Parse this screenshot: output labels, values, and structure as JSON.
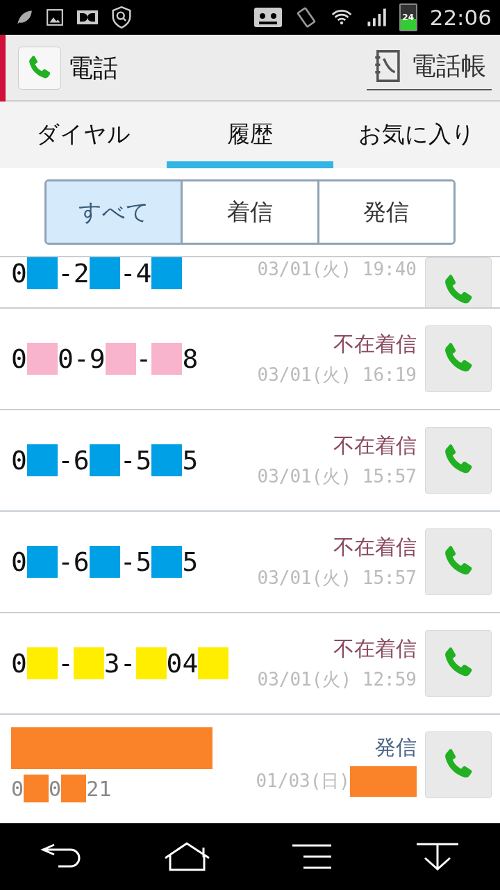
{
  "status_bar": {
    "time": "22:06",
    "battery": "24"
  },
  "app_bar": {
    "title": "電話",
    "contacts_button": "電話帳"
  },
  "tabs": [
    {
      "label": "ダイヤル",
      "selected": false
    },
    {
      "label": "履歴",
      "selected": true
    },
    {
      "label": "お気に入り",
      "selected": false
    }
  ],
  "filters": [
    {
      "label": "すべて",
      "selected": true
    },
    {
      "label": "着信",
      "selected": false
    },
    {
      "label": "発信",
      "selected": false
    }
  ],
  "calls": [
    {
      "number": [
        {
          "kind": "text",
          "text": "0"
        },
        {
          "kind": "redacted",
          "color": "#00a0e6"
        },
        {
          "kind": "text",
          "text": "-2"
        },
        {
          "kind": "redacted",
          "color": "#00a0e6"
        },
        {
          "kind": "text",
          "text": "-4"
        },
        {
          "kind": "redacted",
          "color": "#00a0e6"
        }
      ],
      "date": "03/01(火) 19:40"
    },
    {
      "number": [
        {
          "kind": "text",
          "text": "0"
        },
        {
          "kind": "redacted",
          "color": "#f8b4cc"
        },
        {
          "kind": "text",
          "text": "0-9"
        },
        {
          "kind": "redacted",
          "color": "#f8b4cc"
        },
        {
          "kind": "text",
          "text": "-"
        },
        {
          "kind": "redacted",
          "color": "#f8b4cc"
        },
        {
          "kind": "text",
          "text": "8"
        }
      ],
      "type": "不在着信",
      "color": "#8a4a62",
      "date": "03/01(火) 16:19"
    },
    {
      "number": [
        {
          "kind": "text",
          "text": "0"
        },
        {
          "kind": "redacted",
          "color": "#00a0e6"
        },
        {
          "kind": "text",
          "text": "-6"
        },
        {
          "kind": "redacted",
          "color": "#00a0e6"
        },
        {
          "kind": "text",
          "text": "-5"
        },
        {
          "kind": "redacted",
          "color": "#00a0e6"
        },
        {
          "kind": "text",
          "text": "5"
        }
      ],
      "type": "不在着信",
      "color": "#8a4a62",
      "date": "03/01(火) 15:57"
    },
    {
      "number": [
        {
          "kind": "text",
          "text": "0"
        },
        {
          "kind": "redacted",
          "color": "#00a0e6"
        },
        {
          "kind": "text",
          "text": "-6"
        },
        {
          "kind": "redacted",
          "color": "#00a0e6"
        },
        {
          "kind": "text",
          "text": "-5"
        },
        {
          "kind": "redacted",
          "color": "#00a0e6"
        },
        {
          "kind": "text",
          "text": "5"
        }
      ],
      "type": "不在着信",
      "color": "#8a4a62",
      "date": "03/01(火) 15:57"
    },
    {
      "number": [
        {
          "kind": "text",
          "text": "0"
        },
        {
          "kind": "redacted",
          "color": "#ffee00"
        },
        {
          "kind": "text",
          "text": "-"
        },
        {
          "kind": "redacted",
          "color": "#ffee00"
        },
        {
          "kind": "text",
          "text": "3-"
        },
        {
          "kind": "redacted",
          "color": "#ffee00"
        },
        {
          "kind": "text",
          "text": "04"
        },
        {
          "kind": "redacted",
          "color": "#ffee00"
        }
      ],
      "type": "不在着信",
      "color": "#8a4a62",
      "date": "03/01(火) 12:59"
    },
    {
      "name_redacted": {
        "color": "#fa8228"
      },
      "number": [
        {
          "kind": "text",
          "text": "0"
        },
        {
          "kind": "redacted",
          "color": "#fa8228"
        },
        {
          "kind": "text",
          "text": "0"
        },
        {
          "kind": "redacted",
          "color": "#fa8228"
        },
        {
          "kind": "text",
          "text": "21"
        }
      ],
      "type": "発信",
      "color": "#4a6484",
      "date": "01/03(日)",
      "time_redacted": {
        "color": "#fa8228"
      }
    }
  ]
}
